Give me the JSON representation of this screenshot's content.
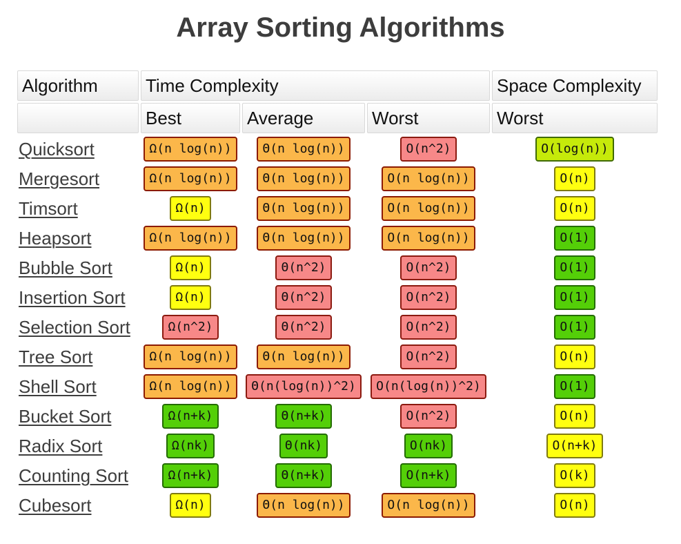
{
  "title": "Array Sorting Algorithms",
  "header": {
    "algorithm": "Algorithm",
    "time_complexity": "Time Complexity",
    "space_complexity": "Space Complexity",
    "best": "Best",
    "average": "Average",
    "worst": "Worst",
    "space_worst": "Worst"
  },
  "colors": {
    "orange": "#fbb74a",
    "red": "#f78888",
    "yellow": "#ffff10",
    "green": "#54cf08",
    "lime": "#c6ea0a"
  },
  "rows": [
    {
      "name": "Quicksort",
      "best": {
        "v": "Ω(n log(n))",
        "c": "orange"
      },
      "avg": {
        "v": "Θ(n log(n))",
        "c": "orange"
      },
      "worst": {
        "v": "O(n^2)",
        "c": "red"
      },
      "space": {
        "v": "O(log(n))",
        "c": "lime"
      }
    },
    {
      "name": "Mergesort",
      "best": {
        "v": "Ω(n log(n))",
        "c": "orange"
      },
      "avg": {
        "v": "Θ(n log(n))",
        "c": "orange"
      },
      "worst": {
        "v": "O(n log(n))",
        "c": "orange"
      },
      "space": {
        "v": "O(n)",
        "c": "yellow"
      }
    },
    {
      "name": "Timsort",
      "best": {
        "v": "Ω(n)",
        "c": "yellow"
      },
      "avg": {
        "v": "Θ(n log(n))",
        "c": "orange"
      },
      "worst": {
        "v": "O(n log(n))",
        "c": "orange"
      },
      "space": {
        "v": "O(n)",
        "c": "yellow"
      }
    },
    {
      "name": "Heapsort",
      "best": {
        "v": "Ω(n log(n))",
        "c": "orange"
      },
      "avg": {
        "v": "Θ(n log(n))",
        "c": "orange"
      },
      "worst": {
        "v": "O(n log(n))",
        "c": "orange"
      },
      "space": {
        "v": "O(1)",
        "c": "green"
      }
    },
    {
      "name": "Bubble Sort",
      "best": {
        "v": "Ω(n)",
        "c": "yellow"
      },
      "avg": {
        "v": "Θ(n^2)",
        "c": "red"
      },
      "worst": {
        "v": "O(n^2)",
        "c": "red"
      },
      "space": {
        "v": "O(1)",
        "c": "green"
      }
    },
    {
      "name": "Insertion Sort",
      "best": {
        "v": "Ω(n)",
        "c": "yellow"
      },
      "avg": {
        "v": "Θ(n^2)",
        "c": "red"
      },
      "worst": {
        "v": "O(n^2)",
        "c": "red"
      },
      "space": {
        "v": "O(1)",
        "c": "green"
      }
    },
    {
      "name": "Selection Sort",
      "best": {
        "v": "Ω(n^2)",
        "c": "red"
      },
      "avg": {
        "v": "Θ(n^2)",
        "c": "red"
      },
      "worst": {
        "v": "O(n^2)",
        "c": "red"
      },
      "space": {
        "v": "O(1)",
        "c": "green"
      }
    },
    {
      "name": "Tree Sort",
      "best": {
        "v": "Ω(n log(n))",
        "c": "orange"
      },
      "avg": {
        "v": "Θ(n log(n))",
        "c": "orange"
      },
      "worst": {
        "v": "O(n^2)",
        "c": "red"
      },
      "space": {
        "v": "O(n)",
        "c": "yellow"
      }
    },
    {
      "name": "Shell Sort",
      "best": {
        "v": "Ω(n log(n))",
        "c": "orange"
      },
      "avg": {
        "v": "Θ(n(log(n))^2)",
        "c": "red"
      },
      "worst": {
        "v": "O(n(log(n))^2)",
        "c": "red"
      },
      "space": {
        "v": "O(1)",
        "c": "green"
      }
    },
    {
      "name": "Bucket Sort",
      "best": {
        "v": "Ω(n+k)",
        "c": "green"
      },
      "avg": {
        "v": "Θ(n+k)",
        "c": "green"
      },
      "worst": {
        "v": "O(n^2)",
        "c": "red"
      },
      "space": {
        "v": "O(n)",
        "c": "yellow"
      }
    },
    {
      "name": "Radix Sort",
      "best": {
        "v": "Ω(nk)",
        "c": "green"
      },
      "avg": {
        "v": "Θ(nk)",
        "c": "green"
      },
      "worst": {
        "v": "O(nk)",
        "c": "green"
      },
      "space": {
        "v": "O(n+k)",
        "c": "yellow"
      }
    },
    {
      "name": "Counting Sort",
      "best": {
        "v": "Ω(n+k)",
        "c": "green"
      },
      "avg": {
        "v": "Θ(n+k)",
        "c": "green"
      },
      "worst": {
        "v": "O(n+k)",
        "c": "green"
      },
      "space": {
        "v": "O(k)",
        "c": "yellow"
      }
    },
    {
      "name": "Cubesort",
      "best": {
        "v": "Ω(n)",
        "c": "yellow"
      },
      "avg": {
        "v": "Θ(n log(n))",
        "c": "orange"
      },
      "worst": {
        "v": "O(n log(n))",
        "c": "orange"
      },
      "space": {
        "v": "O(n)",
        "c": "yellow"
      }
    }
  ]
}
